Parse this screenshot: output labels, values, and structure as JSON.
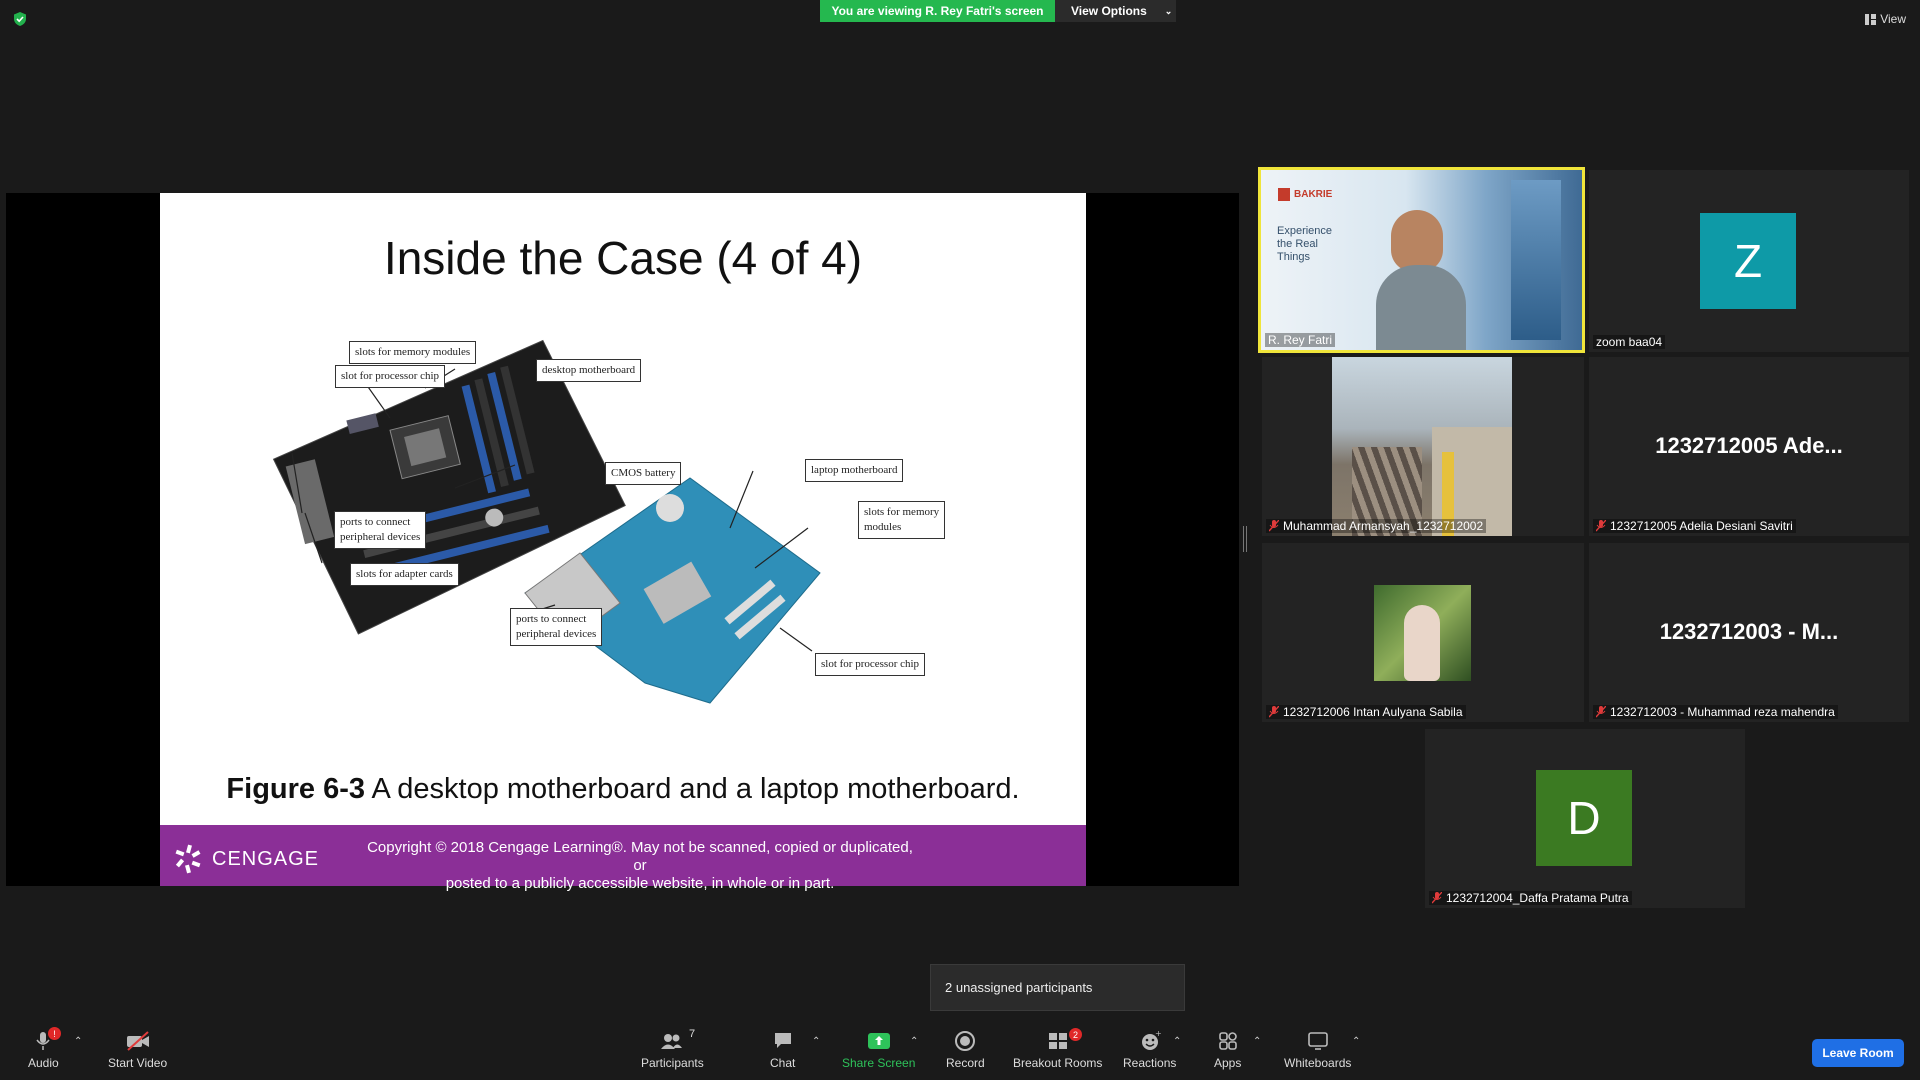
{
  "top": {
    "viewing_banner": "You are viewing R. Rey Fatri's screen",
    "view_options": "View Options",
    "view": "View"
  },
  "slide": {
    "title": "Inside the Case (4 of 4)",
    "callouts": {
      "slots_memory_desktop": "slots for memory modules",
      "slot_processor_desktop": "slot for processor chip",
      "desktop_motherboard": "desktop motherboard",
      "cmos_battery": "CMOS battery",
      "laptop_motherboard": "laptop motherboard",
      "slots_memory_laptop_1": "slots for memory",
      "slots_memory_laptop_2": "modules",
      "ports_desktop_1": "ports to connect",
      "ports_desktop_2": "peripheral devices",
      "slots_adapter": "slots for adapter cards",
      "ports_laptop_1": "ports to connect",
      "ports_laptop_2": "peripheral devices",
      "slot_processor_laptop": "slot for processor chip"
    },
    "caption_bold": "Figure 6-3",
    "caption_text": " A desktop motherboard and a laptop motherboard.",
    "brand": "CENGAGE",
    "copyright_line1": "Copyright © 2018 Cengage Learning®. May not be scanned, copied or duplicated, or",
    "copyright_line2": "posted to a publicly accessible website, in whole or in part."
  },
  "gallery": {
    "speaker": {
      "name": "R. Rey Fatri",
      "brand": "BAKRIE",
      "tagline": [
        "Experience",
        "the Real",
        "Things"
      ]
    },
    "tiles": [
      {
        "name": "zoom baa04",
        "avatar_letter": "Z",
        "avatar_color": "#0e9aa7"
      },
      {
        "name": "Muhammad Armansyah_1232712002"
      },
      {
        "name": "1232712005 Adelia Desiani Savitri",
        "big_name": "1232712005 Ade..."
      },
      {
        "name": "1232712006 Intan Aulyana Sabila"
      },
      {
        "name": "1232712003 - Muhammad reza mahendra",
        "big_name": "1232712003 - M..."
      },
      {
        "name": "1232712004_Daffa Pratama Putra",
        "avatar_letter": "D",
        "avatar_color": "#3b7a22"
      }
    ]
  },
  "popup": {
    "unassigned": "2 unassigned participants"
  },
  "toolbar": {
    "audio": "Audio",
    "audio_badge": "!",
    "start_video": "Start Video",
    "participants": "Participants",
    "participants_count": "7",
    "chat": "Chat",
    "share_screen": "Share Screen",
    "record": "Record",
    "breakout_rooms": "Breakout Rooms",
    "breakout_badge": "2",
    "reactions": "Reactions",
    "apps": "Apps",
    "whiteboards": "Whiteboards",
    "leave_room": "Leave Room"
  },
  "colors": {
    "banner_green": "#25b84f",
    "footer_purple": "#8b2f97",
    "speaker_border": "#f0e53a",
    "leave_blue": "#1f6fe5",
    "share_green": "#2ec25a"
  }
}
